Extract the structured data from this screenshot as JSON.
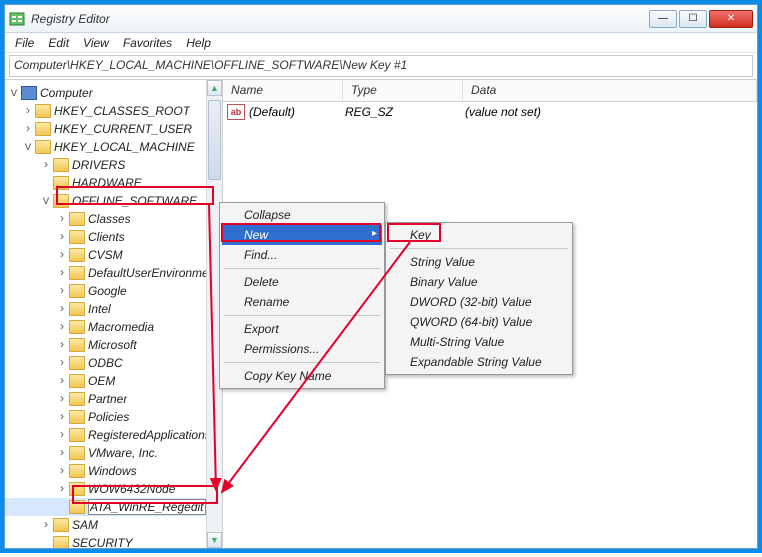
{
  "title": "Registry Editor",
  "menu": {
    "file": "File",
    "edit": "Edit",
    "view": "View",
    "favorites": "Favorites",
    "help": "Help"
  },
  "address": "Computer\\HKEY_LOCAL_MACHINE\\OFFLINE_SOFTWARE\\New Key #1",
  "tree": {
    "root": "Computer",
    "hkcr": "HKEY_CLASSES_ROOT",
    "hkcu": "HKEY_CURRENT_USER",
    "hklm": "HKEY_LOCAL_MACHINE",
    "drivers": "DRIVERS",
    "hardware": "HARDWARE",
    "offsw": "OFFLINE_SOFTWARE",
    "children": [
      "Classes",
      "Clients",
      "CVSM",
      "DefaultUserEnvironment",
      "Google",
      "Intel",
      "Macromedia",
      "Microsoft",
      "ODBC",
      "OEM",
      "Partner",
      "Policies",
      "RegisteredApplications",
      "VMware, Inc.",
      "Windows",
      "WOW6432Node"
    ],
    "newkey": "ATA_WinRE_Regedit",
    "sam": "SAM",
    "security": "SECURITY"
  },
  "values": {
    "headers": {
      "name": "Name",
      "type": "Type",
      "data": "Data"
    },
    "default": {
      "name": "(Default)",
      "type": "REG_SZ",
      "data": "(value not set)"
    }
  },
  "ctx1": {
    "collapse": "Collapse",
    "new": "New",
    "find": "Find...",
    "delete": "Delete",
    "rename": "Rename",
    "export": "Export",
    "permissions": "Permissions...",
    "copy": "Copy Key Name"
  },
  "ctx2": {
    "key": "Key",
    "string": "String Value",
    "binary": "Binary Value",
    "dword": "DWORD (32-bit) Value",
    "qword": "QWORD (64-bit) Value",
    "multi": "Multi-String Value",
    "expand": "Expandable String Value"
  }
}
